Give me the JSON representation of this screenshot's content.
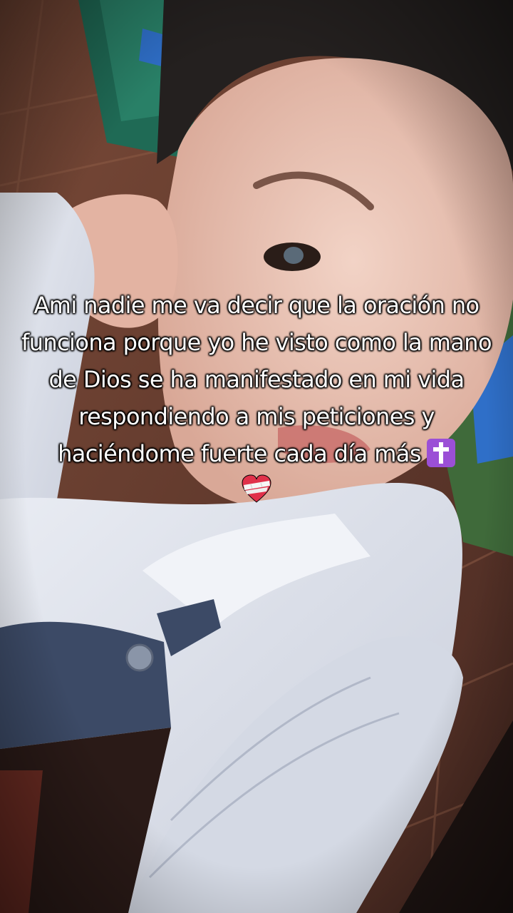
{
  "image": {
    "description_icon": "photo-background",
    "colors": {
      "sweater": "#dfe3ec",
      "skin": "#e8bfae",
      "hair": "#24201f",
      "floor": "#6b3d2f",
      "accent_green": "#1f6a55",
      "accent_blue": "#2f6fc8"
    }
  },
  "caption": {
    "text": "Ami nadie me va decir que la oración no funciona porque yo he visto como la mano de Dios se ha manifestado en mi vida respondiendo a mis peticiones y haciéndome fuerte cada día más",
    "cross_icon": "latin-cross-emoji",
    "heart_icon": "mending-heart-emoji"
  }
}
